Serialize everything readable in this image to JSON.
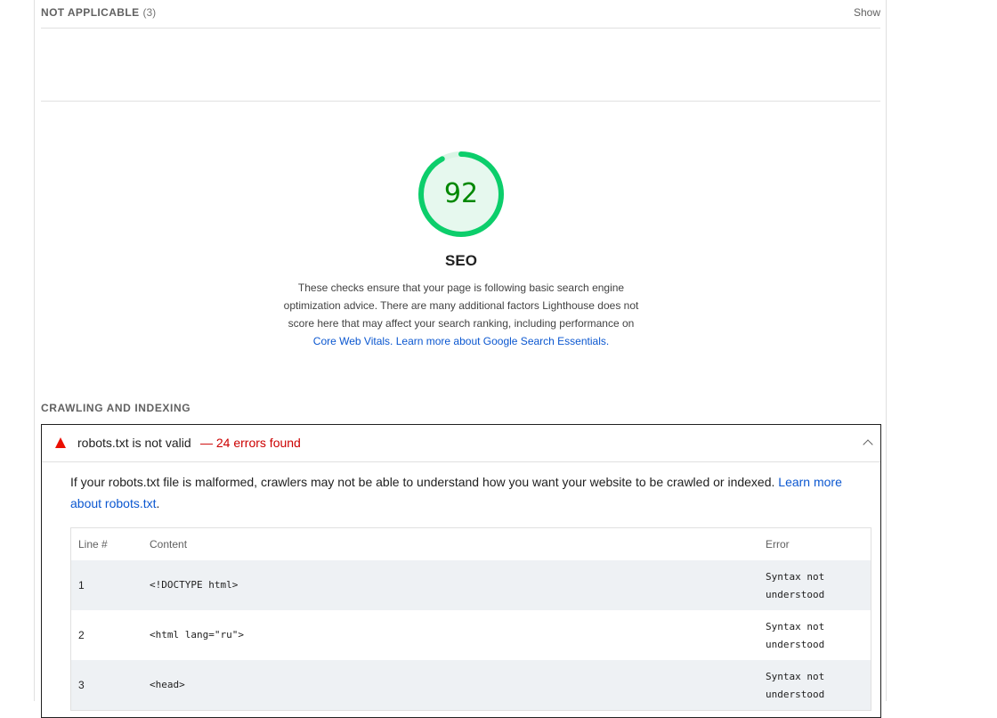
{
  "not_applicable": {
    "title": "NOT APPLICABLE",
    "count": "(3)",
    "toggle_label": "Show"
  },
  "seo": {
    "score": "92",
    "score_color": "#0cce6b",
    "score_fraction": 0.92,
    "title": "SEO",
    "description": "These checks ensure that your page is following basic search engine optimization advice. There are many additional factors Lighthouse does not score here that may affect your search ranking, including performance on ",
    "link_cwv": "Core Web Vitals",
    "separator": ". ",
    "link_learn": "Learn more about Google Search Essentials",
    "end": "."
  },
  "crawling": {
    "title": "CRAWLING AND INDEXING"
  },
  "audit": {
    "status_icon": "fail-triangle-icon",
    "status_color": "#eb0f00",
    "title": "robots.txt is not valid",
    "display_value": "— 24 errors found",
    "description": "If your robots.txt file is malformed, crawlers may not be able to understand how you want your website to be crawled or indexed. ",
    "learn_link": "Learn more about robots.txt",
    "desc_end": ".",
    "columns": {
      "line": "Line #",
      "content": "Content",
      "error": "Error"
    },
    "rows": [
      {
        "line": "1",
        "content": "<!DOCTYPE html>",
        "error": "Syntax not understood"
      },
      {
        "line": "2",
        "content": "<html lang=\"ru\">",
        "error": "Syntax not understood"
      },
      {
        "line": "3",
        "content": "<head>",
        "error": "Syntax not understood"
      }
    ]
  }
}
